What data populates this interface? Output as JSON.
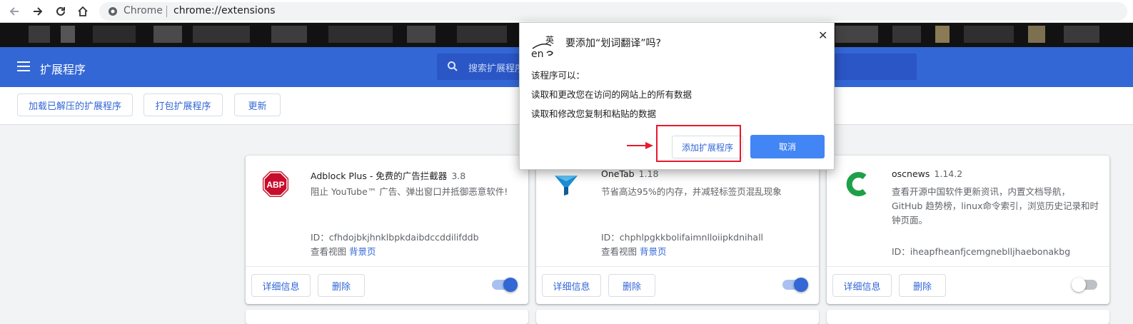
{
  "browser": {
    "site_label": "Chrome",
    "url": "chrome://extensions"
  },
  "header": {
    "title": "扩展程序",
    "search_placeholder": "搜索扩展程序"
  },
  "subbar": {
    "load_unpacked": "加载已解压的扩展程序",
    "pack": "打包扩展程序",
    "update": "更新"
  },
  "extensions": [
    {
      "name": "Adblock Plus - 免费的广告拦截器",
      "version": "3.8",
      "description": "阻止 YouTube™ 广告、弹出窗口并抵御恶意软件!",
      "id": "ID：cfhdojbkjhnklbpkdaibdccddilifddb",
      "view_label": "查看视图",
      "view_link": "背景页",
      "details": "详细信息",
      "remove": "删除",
      "enabled": true,
      "icon": "abp-icon"
    },
    {
      "name": "OneTab",
      "version": "1.18",
      "description": "节省高达95%的内存，并减轻标签页混乱现象",
      "id": "ID：chphlpgkkbolifaimnlloiipkdnihall",
      "view_label": "查看视图",
      "view_link": "背景页",
      "details": "详细信息",
      "remove": "删除",
      "enabled": true,
      "icon": "onetab-funnel-icon"
    },
    {
      "name": "oscnews",
      "version": "1.14.2",
      "description": "查看开源中国软件更新资讯，内置文档导航，GitHub 趋势榜，linux命令索引，浏览历史记录和时钟页面。",
      "id": "ID：iheapfheanfjcemgneblljhaebonakbg",
      "details": "详细信息",
      "remove": "删除",
      "enabled": false,
      "icon": "oscnews-c-icon"
    }
  ],
  "dialog": {
    "logo_text_top": "英",
    "logo_text_bottom": "en",
    "title": "要添加“划词翻译”吗?",
    "can_label": "该程序可以：",
    "permissions": [
      "读取和更改您在访问的网站上的所有数据",
      "读取和修改您复制和粘贴的数据"
    ],
    "add_button": "添加扩展程序",
    "cancel_button": "取消",
    "close": "✕"
  },
  "colors": {
    "header_blue": "#3367d6",
    "primary_button": "#4285f4",
    "highlight_red": "#e8192c"
  }
}
